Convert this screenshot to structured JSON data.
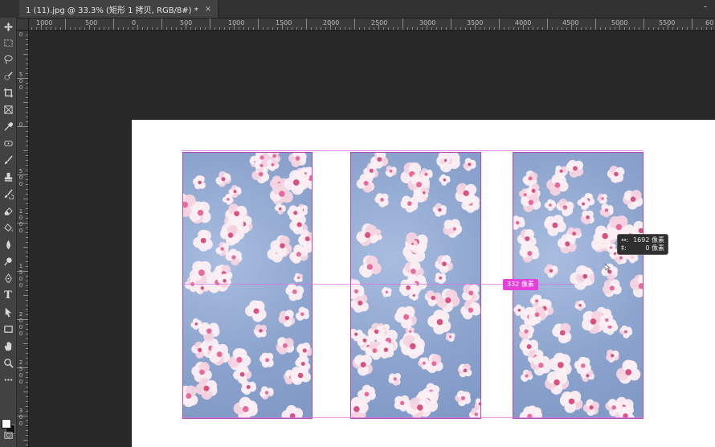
{
  "document_tab": {
    "title": "1 (11).jpg @ 33.3% (矩形 1 拷贝, RGB/8#) *",
    "close": "×"
  },
  "window_control": "-",
  "toolbar": {
    "text_tool_glyph": "T",
    "tools": [
      "move-icon",
      "marquee-icon",
      "lasso-icon",
      "quick-select-icon",
      "crop-icon",
      "frame-icon",
      "eyedropper-icon",
      "patch-icon",
      "brush-icon",
      "stamp-icon",
      "history-brush-icon",
      "eraser-icon",
      "paint-bucket-icon",
      "blur-icon",
      "dodge-icon",
      "pen-icon",
      "type-icon",
      "path-select-icon",
      "rectangle-icon",
      "hand-icon",
      "zoom-icon",
      "more-icon"
    ],
    "foreground_color": "#ffffff",
    "background_color": "#111111"
  },
  "ruler_h": {
    "labels": [
      "1000",
      "500",
      "0",
      "500",
      "1000",
      "1500",
      "2000",
      "2500",
      "3000",
      "3500",
      "4000",
      "4500",
      "5000",
      "5500",
      "60"
    ]
  },
  "ruler_v": {
    "labels": [
      "0",
      "5 0 0",
      "0",
      "5 0 0",
      "1 0 0 0",
      "1 5 0 0",
      "2 0 0 0",
      "2 5 0 0",
      "3 0 0"
    ]
  },
  "smart_guide": {
    "distance_label": "332 像素"
  },
  "hud": {
    "row1_label": "↔:",
    "row1_value": "1692 像素",
    "row2_label": "‡:",
    "row2_value": "0 像素"
  },
  "colors": {
    "guide": "#e36ce9",
    "measure_badge": "#e540d9",
    "panel_border": "#b04bb6",
    "pasteboard": "#282828"
  }
}
